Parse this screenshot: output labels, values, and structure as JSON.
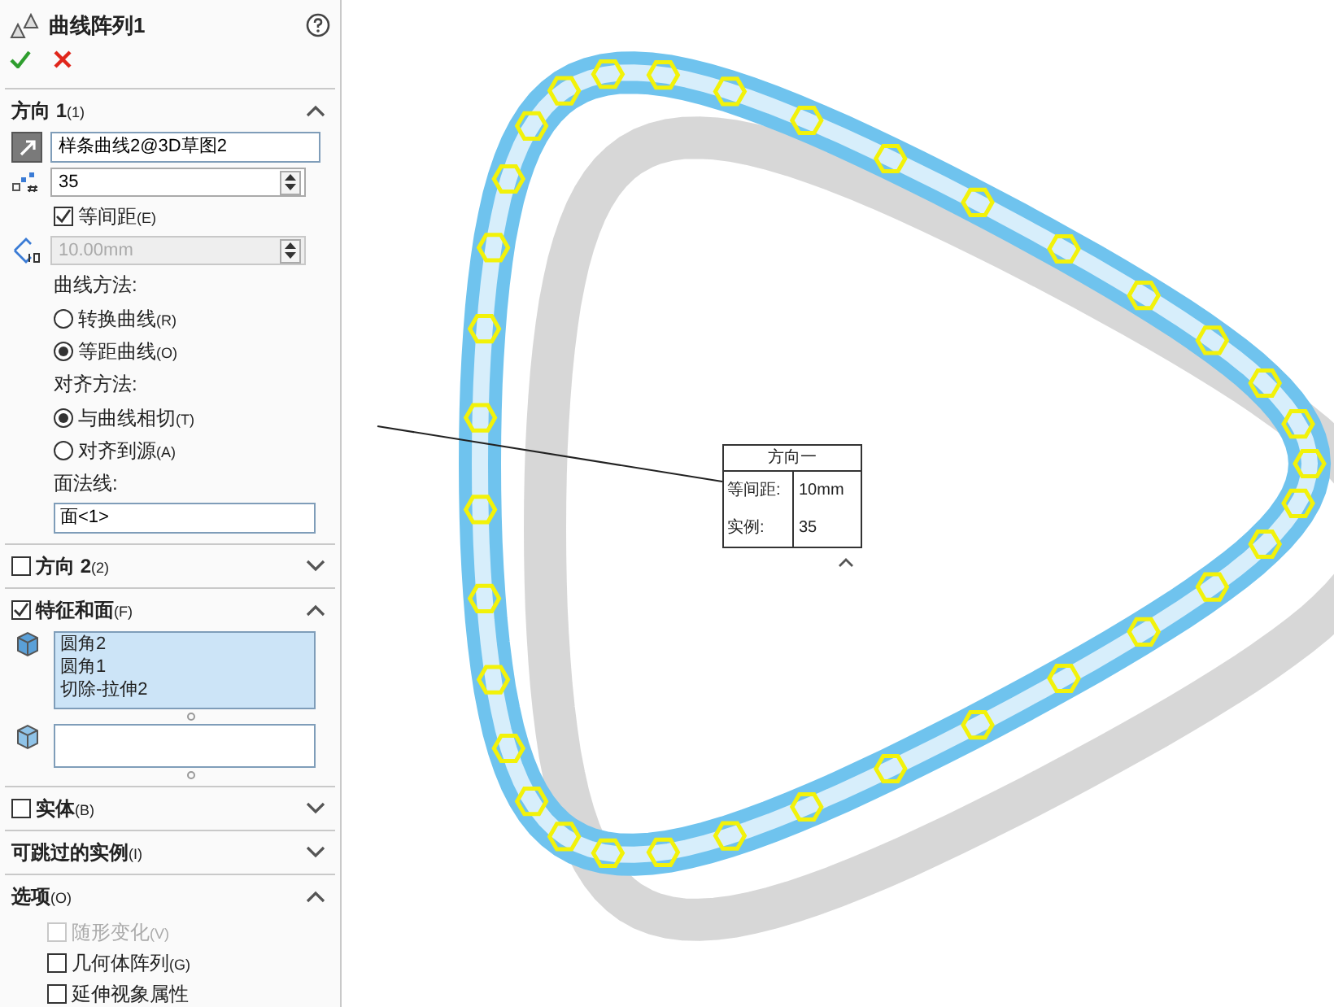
{
  "feature": {
    "title": "曲线阵列1"
  },
  "direction1": {
    "title": "方向 1",
    "shortcut": "(1)",
    "expanded": true,
    "curve_field": "样条曲线2@3D草图2",
    "count": "35",
    "equal_spacing": {
      "label": "等间距",
      "shortcut": "(E)",
      "checked": true
    },
    "spacing": {
      "value": "10.00mm",
      "disabled": true
    },
    "curve_method_label": "曲线方法:",
    "curve_methods": [
      {
        "label": "转换曲线",
        "shortcut": "(R)",
        "selected": false
      },
      {
        "label": "等距曲线",
        "shortcut": "(O)",
        "selected": true
      }
    ],
    "align_label": "对齐方法:",
    "align_methods": [
      {
        "label": "与曲线相切",
        "shortcut": "(T)",
        "selected": true
      },
      {
        "label": "对齐到源",
        "shortcut": "(A)",
        "selected": false
      }
    ],
    "face_normal_label": "面法线:",
    "face_normal": "面<1>"
  },
  "direction2": {
    "title": "方向 2",
    "shortcut": "(2)",
    "checked": false,
    "expanded": false
  },
  "features": {
    "title": "特征和面",
    "shortcut": "(F)",
    "checked": true,
    "expanded": true,
    "items": [
      "圆角2",
      "圆角1",
      "切除-拉伸2"
    ]
  },
  "bodies": {
    "title": "实体",
    "shortcut": "(B)",
    "checked": false,
    "expanded": false
  },
  "skip_instances": {
    "title": "可跳过的实例",
    "shortcut": "(I)",
    "expanded": false
  },
  "options": {
    "title": "选项",
    "shortcut": "(O)",
    "expanded": true,
    "items": [
      {
        "label": "随形变化",
        "shortcut": "(V)",
        "checked": false,
        "disabled": true
      },
      {
        "label": "几何体阵列",
        "shortcut": "(G)",
        "checked": false,
        "disabled": false
      },
      {
        "label": "延伸视象属性",
        "checked": false,
        "disabled": false
      }
    ]
  },
  "callout": {
    "title": "方向一",
    "rows": [
      {
        "label": "等间距:",
        "value": "10mm"
      },
      {
        "label": "实例:",
        "value": "35"
      }
    ]
  }
}
